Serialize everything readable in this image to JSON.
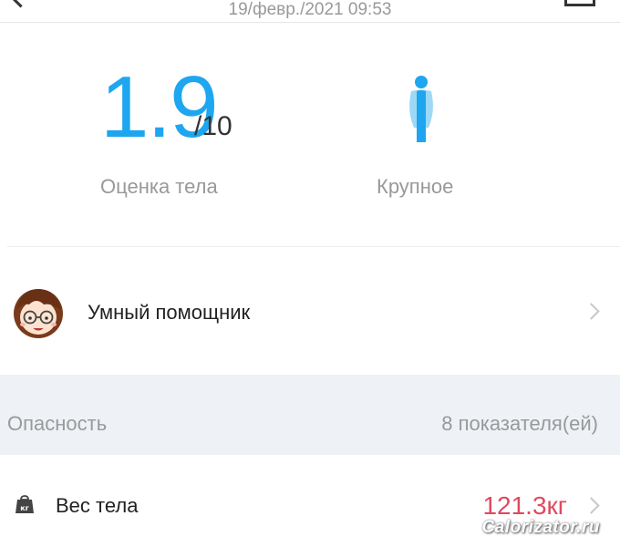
{
  "header": {
    "date": "19/февр./2021 09:53",
    "back_icon": "back-arrow-icon",
    "share_icon": "share-icon"
  },
  "score": {
    "value": "1.9",
    "max": "/10",
    "label": "Оценка тела",
    "accent_color": "#1ea6f0"
  },
  "body_type": {
    "label": "Крупное",
    "icon": "body-figure-icon"
  },
  "assistant": {
    "label": "Умный помощник",
    "icon": "avatar"
  },
  "danger_section": {
    "title": "Опасность",
    "count": "8 показателя(ей)"
  },
  "metrics": [
    {
      "label": "Вес тела",
      "value": "121.3кг",
      "value_color": "#e04a5f",
      "icon": "kg-weight-icon"
    }
  ],
  "watermark": "Calorizator.ru"
}
